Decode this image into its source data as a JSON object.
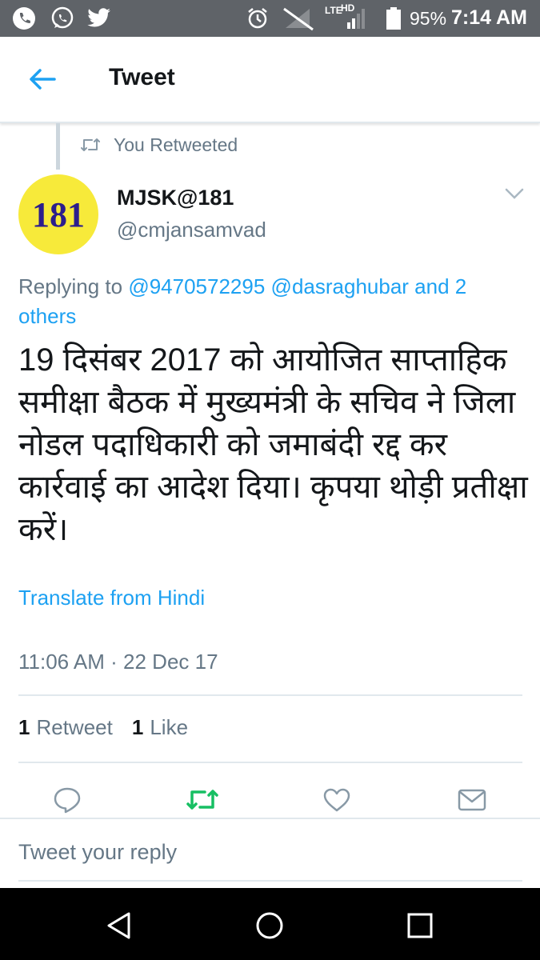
{
  "status_bar": {
    "lte_label": "LTE",
    "hd_label": "HD",
    "battery_percent": "95%",
    "time": "7:14 AM"
  },
  "header": {
    "title": "Tweet"
  },
  "retweet_context": {
    "label": "You Retweeted"
  },
  "tweet": {
    "avatar_text": "181",
    "display_name": "MJSK@181",
    "handle": "@cmjansamvad",
    "replying_prefix": "Replying to ",
    "reply_mentions": [
      "@9470572295",
      "@dasraghubar",
      "and 2 others"
    ],
    "text": "19 दिसंबर 2017 को आयोजित साप्ताहिक समीक्षा बैठक में मुख्यमंत्री के सचिव ने जिला नोडल पदाधिकारी को जमाबंदी रद्द कर कार्रवाई का आदेश दिया। कृपया थोड़ी प्रतीक्षा करें।",
    "translate_label": "Translate from Hindi",
    "timestamp": "11:06 AM · 22 Dec 17",
    "retweet_count": "1",
    "retweet_label": "Retweet",
    "like_count": "1",
    "like_label": "Like"
  },
  "reply_box": {
    "placeholder": "Tweet your reply"
  },
  "colors": {
    "accent": "#1da1f2",
    "retweet_green": "#17bf63",
    "secondary_text": "#657786"
  }
}
